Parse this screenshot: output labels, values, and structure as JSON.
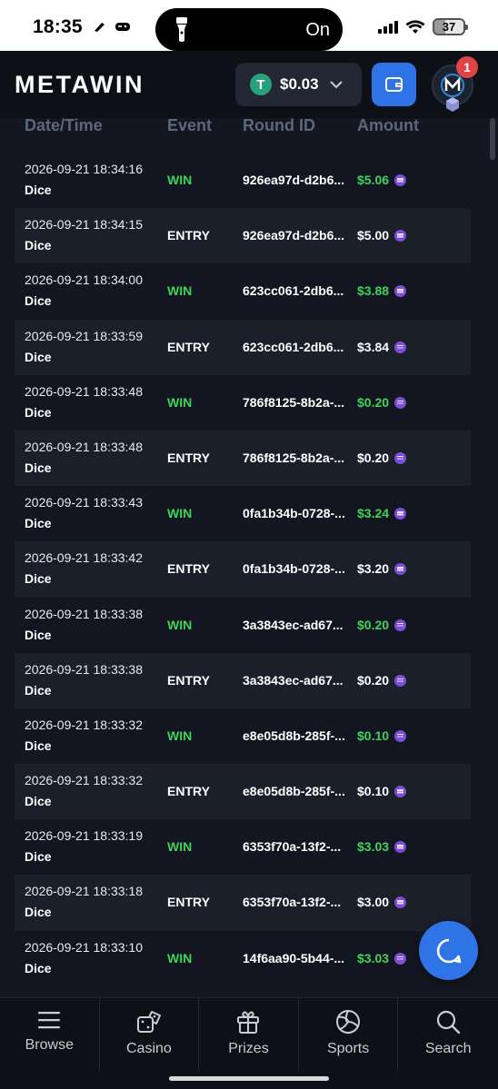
{
  "status_bar": {
    "time": "18:35",
    "island_text": "On",
    "battery": "37"
  },
  "header": {
    "logo": "METAWIN",
    "balance": "$0.03",
    "notification_count": "1"
  },
  "table": {
    "columns": [
      "Date/Time",
      "Event",
      "Round ID",
      "Amount"
    ],
    "rows": [
      {
        "date": "2026-09-21 18:34:16",
        "game": "Dice",
        "event": "WIN",
        "round": "926ea97d-d2b6...",
        "amount": "$5.06"
      },
      {
        "date": "2026-09-21 18:34:15",
        "game": "Dice",
        "event": "ENTRY",
        "round": "926ea97d-d2b6...",
        "amount": "$5.00"
      },
      {
        "date": "2026-09-21 18:34:00",
        "game": "Dice",
        "event": "WIN",
        "round": "623cc061-2db6...",
        "amount": "$3.88"
      },
      {
        "date": "2026-09-21 18:33:59",
        "game": "Dice",
        "event": "ENTRY",
        "round": "623cc061-2db6...",
        "amount": "$3.84"
      },
      {
        "date": "2026-09-21 18:33:48",
        "game": "Dice",
        "event": "WIN",
        "round": "786f8125-8b2a-...",
        "amount": "$0.20"
      },
      {
        "date": "2026-09-21 18:33:48",
        "game": "Dice",
        "event": "ENTRY",
        "round": "786f8125-8b2a-...",
        "amount": "$0.20"
      },
      {
        "date": "2026-09-21 18:33:43",
        "game": "Dice",
        "event": "WIN",
        "round": "0fa1b34b-0728-...",
        "amount": "$3.24"
      },
      {
        "date": "2026-09-21 18:33:42",
        "game": "Dice",
        "event": "ENTRY",
        "round": "0fa1b34b-0728-...",
        "amount": "$3.20"
      },
      {
        "date": "2026-09-21 18:33:38",
        "game": "Dice",
        "event": "WIN",
        "round": "3a3843ec-ad67...",
        "amount": "$0.20"
      },
      {
        "date": "2026-09-21 18:33:38",
        "game": "Dice",
        "event": "ENTRY",
        "round": "3a3843ec-ad67...",
        "amount": "$0.20"
      },
      {
        "date": "2026-09-21 18:33:32",
        "game": "Dice",
        "event": "WIN",
        "round": "e8e05d8b-285f-...",
        "amount": "$0.10"
      },
      {
        "date": "2026-09-21 18:33:32",
        "game": "Dice",
        "event": "ENTRY",
        "round": "e8e05d8b-285f-...",
        "amount": "$0.10"
      },
      {
        "date": "2026-09-21 18:33:19",
        "game": "Dice",
        "event": "WIN",
        "round": "6353f70a-13f2-...",
        "amount": "$3.03"
      },
      {
        "date": "2026-09-21 18:33:18",
        "game": "Dice",
        "event": "ENTRY",
        "round": "6353f70a-13f2-...",
        "amount": "$3.00"
      },
      {
        "date": "2026-09-21 18:33:10",
        "game": "Dice",
        "event": "WIN",
        "round": "14f6aa90-5b44-...",
        "amount": "$3.03"
      }
    ]
  },
  "nav": [
    {
      "label": "Browse",
      "icon": "menu-icon"
    },
    {
      "label": "Casino",
      "icon": "dice-icon"
    },
    {
      "label": "Prizes",
      "icon": "gift-icon"
    },
    {
      "label": "Sports",
      "icon": "volleyball-icon"
    },
    {
      "label": "Search",
      "icon": "search-icon"
    }
  ],
  "colors": {
    "win": "#3fd35a",
    "accent": "#2f74e6",
    "tether": "#26a17b",
    "coin": "#7a4fd6"
  }
}
